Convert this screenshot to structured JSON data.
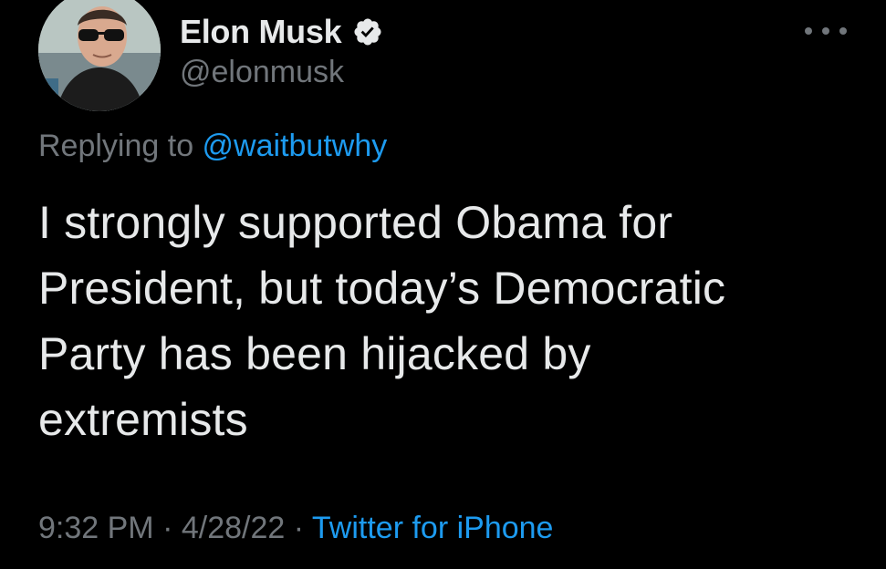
{
  "author": {
    "display_name": "Elon Musk",
    "handle": "@elonmusk",
    "verified": true,
    "avatar_icon": "profile-photo"
  },
  "reply": {
    "prefix": "Replying to ",
    "mention": "@waitbutwhy"
  },
  "tweet": {
    "text": "I strongly supported Obama for\nPresident, but today’s Democratic\nParty has been hijacked by\nextremists"
  },
  "meta": {
    "time": "9:32 PM",
    "separator": " · ",
    "date": "4/28/22",
    "source": "Twitter for iPhone"
  },
  "icons": {
    "verified": "verified-badge-icon",
    "more": "more-options-icon"
  },
  "colors": {
    "background": "#000000",
    "text": "#e7e9ea",
    "secondary": "#71767b",
    "accent": "#1d9bf0"
  }
}
